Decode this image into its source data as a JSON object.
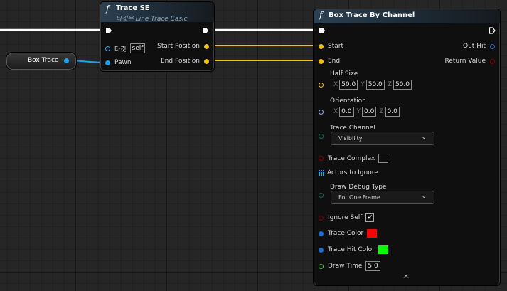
{
  "colors": {
    "exec": "#ffffff",
    "vector_pin": "#f2c10e",
    "object_pin": "#1ba2ef",
    "rotator_pin": "#9aa6e8",
    "byte_pin": "#0e6b5e",
    "bool_pin": "#8a0000",
    "color_pin": "#1a6cd4",
    "float_pin": "#4cc14a",
    "trace_color": "#ff0000",
    "trace_hit_color": "#00ff00"
  },
  "var_node": {
    "label": "Box Trace"
  },
  "trace_se": {
    "title": "Trace SE",
    "subtitle": "타깃은 Line Trace Basic",
    "target_label": "타깃",
    "target_value": "self",
    "pawn_label": "Pawn",
    "start_position": "Start Position",
    "end_position": "End Position"
  },
  "box_trace": {
    "title": "Box Trace By Channel",
    "start": "Start",
    "end": "End",
    "out_hit": "Out Hit",
    "return_value": "Return Value",
    "half_size_label": "Half Size",
    "half_size": {
      "x_label": "X",
      "x": "50.0",
      "y_label": "Y",
      "y": "50.0",
      "z_label": "Z",
      "z": "50.0"
    },
    "orientation_label": "Orientation",
    "orientation": {
      "x_label": "X",
      "x": "0.0",
      "y_label": "Y",
      "y": "0.0",
      "z_label": "Z",
      "z": "0.0"
    },
    "trace_channel_label": "Trace Channel",
    "trace_channel_value": "Visibility",
    "trace_complex_label": "Trace Complex",
    "actors_to_ignore_label": "Actors to Ignore",
    "draw_debug_type_label": "Draw Debug Type",
    "draw_debug_type_value": "For One Frame",
    "ignore_self_label": "Ignore Self",
    "ignore_self_checked": true,
    "ignore_self_mark": "✔",
    "trace_color_label": "Trace Color",
    "trace_hit_color_label": "Trace Hit Color",
    "draw_time_label": "Draw Time",
    "draw_time_value": "5.0"
  },
  "icons": {
    "function": "f",
    "chevron": "⌄",
    "array_grid": "grid-icon",
    "expand_caret": "^"
  }
}
